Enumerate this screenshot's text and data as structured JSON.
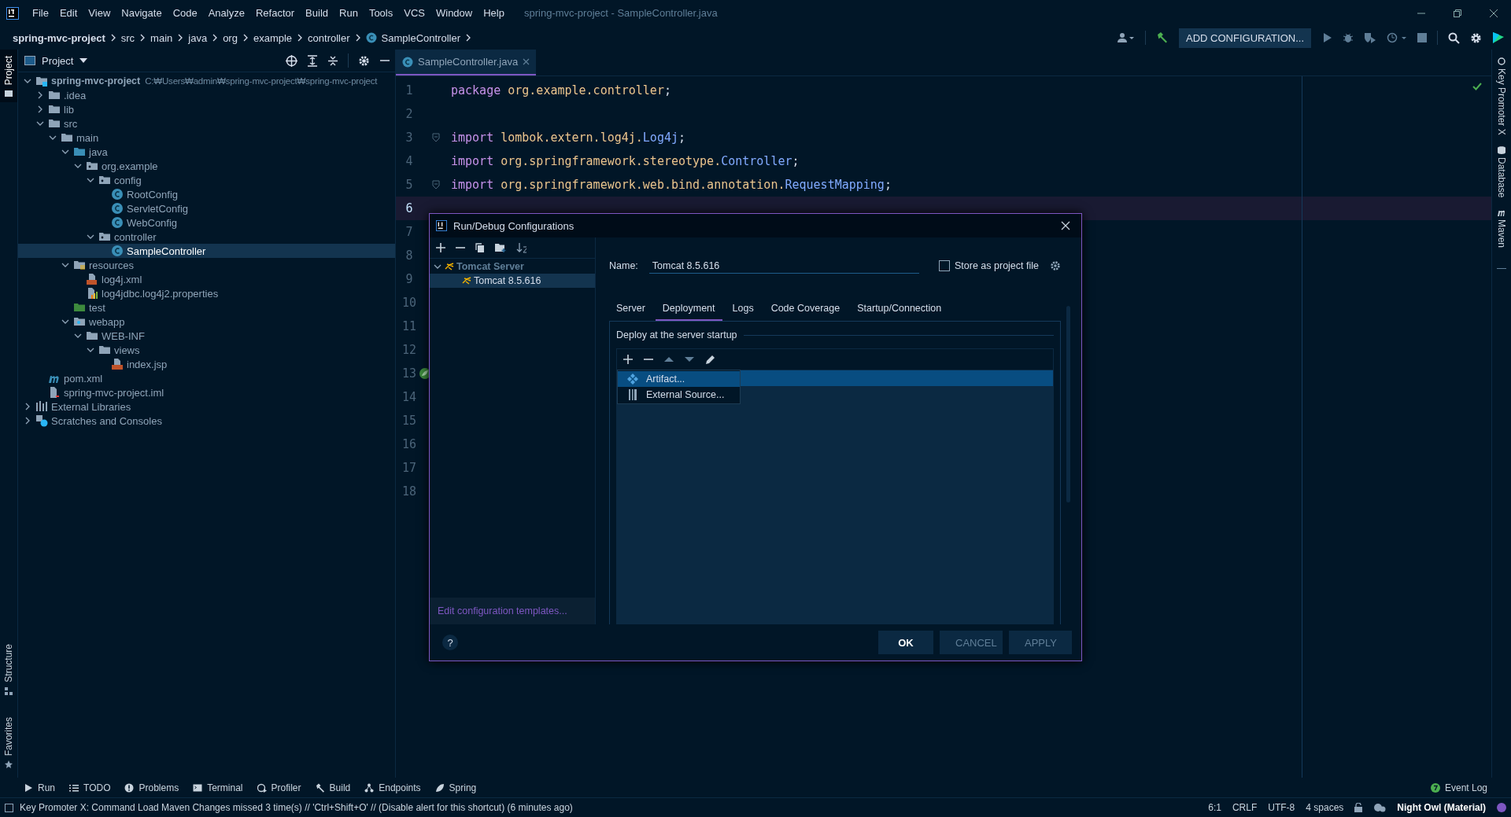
{
  "window": {
    "title": "spring-mvc-project - SampleController.java"
  },
  "menu": [
    "File",
    "Edit",
    "View",
    "Navigate",
    "Code",
    "Analyze",
    "Refactor",
    "Build",
    "Run",
    "Tools",
    "VCS",
    "Window",
    "Help"
  ],
  "breadcrumb": [
    {
      "label": "spring-mvc-project",
      "kind": "project"
    },
    {
      "label": "src",
      "kind": "dir"
    },
    {
      "label": "main",
      "kind": "dir"
    },
    {
      "label": "java",
      "kind": "dir"
    },
    {
      "label": "org",
      "kind": "dir"
    },
    {
      "label": "example",
      "kind": "dir"
    },
    {
      "label": "controller",
      "kind": "dir"
    },
    {
      "label": "SampleController",
      "kind": "class"
    }
  ],
  "toolbar": {
    "config_button": "ADD CONFIGURATION..."
  },
  "left_strip_top": [
    {
      "label": "Project",
      "selected": true,
      "kind": "project"
    }
  ],
  "left_strip_bottom": [
    {
      "label": "Structure",
      "selected": false,
      "kind": "structure"
    },
    {
      "label": "Favorites",
      "selected": false,
      "kind": "favorites"
    }
  ],
  "right_strip": [
    {
      "label": "Key Promoter X",
      "kind": "promoter"
    },
    {
      "label": "Database",
      "kind": "database"
    },
    {
      "label": "Maven",
      "kind": "maven"
    }
  ],
  "project_panel": {
    "title": "Project",
    "tree": [
      {
        "label": "spring-mvc-project",
        "detail": "C:₩Users₩admin₩spring-mvc-project₩spring-mvc-project",
        "kind": "module",
        "expanded": true,
        "selected": false,
        "children": [
          {
            "label": ".idea",
            "kind": "folder",
            "expanded": false,
            "selected": false
          },
          {
            "label": "lib",
            "kind": "folder",
            "expanded": false,
            "selected": false
          },
          {
            "label": "src",
            "kind": "folder",
            "expanded": true,
            "selected": false,
            "children": [
              {
                "label": "main",
                "kind": "folder",
                "expanded": true,
                "selected": false,
                "children": [
                  {
                    "label": "java",
                    "kind": "source",
                    "expanded": true,
                    "selected": false,
                    "children": [
                      {
                        "label": "org.example",
                        "kind": "package",
                        "expanded": true,
                        "selected": false,
                        "children": [
                          {
                            "label": "config",
                            "kind": "package",
                            "expanded": true,
                            "selected": false,
                            "children": [
                              {
                                "label": "RootConfig",
                                "kind": "class",
                                "selected": false
                              },
                              {
                                "label": "ServletConfig",
                                "kind": "class",
                                "selected": false
                              },
                              {
                                "label": "WebConfig",
                                "kind": "class",
                                "selected": false
                              }
                            ]
                          },
                          {
                            "label": "controller",
                            "kind": "package",
                            "expanded": true,
                            "selected": false,
                            "children": [
                              {
                                "label": "SampleController",
                                "kind": "class",
                                "selected": true
                              }
                            ]
                          }
                        ]
                      }
                    ]
                  },
                  {
                    "label": "resources",
                    "kind": "resources",
                    "expanded": true,
                    "selected": false,
                    "children": [
                      {
                        "label": "log4j.xml",
                        "kind": "xml",
                        "selected": false
                      },
                      {
                        "label": "log4jdbc.log4j2.properties",
                        "kind": "properties",
                        "selected": false
                      }
                    ]
                  },
                  {
                    "label": "test",
                    "kind": "test",
                    "selected": false
                  },
                  {
                    "label": "webapp",
                    "kind": "web",
                    "expanded": true,
                    "selected": false,
                    "children": [
                      {
                        "label": "WEB-INF",
                        "kind": "folder",
                        "expanded": true,
                        "selected": false,
                        "children": [
                          {
                            "label": "views",
                            "kind": "folder",
                            "expanded": true,
                            "selected": false,
                            "children": [
                              {
                                "label": "index.jsp",
                                "kind": "jsp",
                                "selected": false
                              }
                            ]
                          }
                        ]
                      }
                    ]
                  }
                ]
              }
            ]
          },
          {
            "label": "pom.xml",
            "kind": "maven",
            "selected": false
          },
          {
            "label": "spring-mvc-project.iml",
            "kind": "iml",
            "selected": false
          }
        ]
      },
      {
        "label": "External Libraries",
        "kind": "libraries",
        "expanded": false,
        "selected": false
      },
      {
        "label": "Scratches and Consoles",
        "kind": "scratches",
        "expanded": false,
        "selected": false
      }
    ]
  },
  "editor": {
    "tabs": [
      {
        "label": "SampleController.java",
        "selected": true
      }
    ],
    "lines": [
      {
        "number": "1",
        "current": false,
        "kind": "plain",
        "tokens": [
          {
            "text": "package ",
            "kind": "keyword"
          },
          {
            "text": "org.example.controller",
            "kind": "package"
          },
          {
            "text": ";",
            "kind": "plain"
          }
        ]
      },
      {
        "number": "2",
        "current": false,
        "kind": "plain"
      },
      {
        "number": "3",
        "current": false,
        "kind": "fold",
        "tokens": [
          {
            "text": "import ",
            "kind": "keyword"
          },
          {
            "text": "lombok.extern.log4j.",
            "kind": "package"
          },
          {
            "text": "Log4j",
            "kind": "class"
          },
          {
            "text": ";",
            "kind": "plain"
          }
        ]
      },
      {
        "number": "4",
        "current": false,
        "kind": "plain",
        "tokens": [
          {
            "text": "import ",
            "kind": "keyword"
          },
          {
            "text": "org.springframework.stereotype.",
            "kind": "package"
          },
          {
            "text": "Controller",
            "kind": "class"
          },
          {
            "text": ";",
            "kind": "plain"
          }
        ]
      },
      {
        "number": "5",
        "current": false,
        "kind": "fold",
        "tokens": [
          {
            "text": "import ",
            "kind": "keyword"
          },
          {
            "text": "org.springframework.web.bind.annotation.",
            "kind": "package"
          },
          {
            "text": "RequestMapping",
            "kind": "class"
          },
          {
            "text": ";",
            "kind": "plain"
          }
        ]
      },
      {
        "number": "6",
        "current": true,
        "kind": "plain"
      },
      {
        "number": "7",
        "current": false,
        "kind": "plain"
      },
      {
        "number": "8",
        "current": false,
        "kind": "plain"
      },
      {
        "number": "9",
        "current": false,
        "kind": "plain"
      },
      {
        "number": "10",
        "current": false,
        "kind": "plain"
      },
      {
        "number": "11",
        "current": false,
        "kind": "plain"
      },
      {
        "number": "12",
        "current": false,
        "kind": "plain"
      },
      {
        "number": "13",
        "current": false,
        "kind": "bean"
      },
      {
        "number": "14",
        "current": false,
        "kind": "plain"
      },
      {
        "number": "15",
        "current": false,
        "kind": "plain"
      },
      {
        "number": "16",
        "current": false,
        "kind": "plain"
      },
      {
        "number": "17",
        "current": false,
        "kind": "plain"
      },
      {
        "number": "18",
        "current": false,
        "kind": "plain"
      }
    ]
  },
  "dialog": {
    "title": "Run/Debug Configurations",
    "tree": [
      {
        "label": "Tomcat Server",
        "expanded": true,
        "selected": false,
        "children": [
          {
            "label": "Tomcat 8.5.616",
            "selected": true
          }
        ]
      }
    ],
    "templates_link": "Edit configuration templates...",
    "name_label": "Name:",
    "name_value": "Tomcat 8.5.616",
    "store_option": {
      "label": "Store as project file",
      "checked": false
    },
    "tabs": [
      {
        "label": "Server",
        "selected": false
      },
      {
        "label": "Deployment",
        "selected": true
      },
      {
        "label": "Logs",
        "selected": false
      },
      {
        "label": "Code Coverage",
        "selected": false
      },
      {
        "label": "Startup/Connection",
        "selected": false
      }
    ],
    "section_title": "Deploy at the server startup",
    "add_menu": [
      {
        "label": "Artifact...",
        "kind": "artifact",
        "selected": true
      },
      {
        "label": "External Source...",
        "kind": "external",
        "selected": false
      }
    ],
    "help": "?",
    "buttons": [
      {
        "label": "OK",
        "kind": "primary"
      },
      {
        "label": "CANCEL",
        "kind": "normal"
      },
      {
        "label": "APPLY",
        "kind": "normal"
      }
    ]
  },
  "tool_windows": [
    {
      "label": "Run",
      "kind": "run"
    },
    {
      "label": "TODO",
      "kind": "todo"
    },
    {
      "label": "Problems",
      "kind": "problems"
    },
    {
      "label": "Terminal",
      "kind": "terminal"
    },
    {
      "label": "Profiler",
      "kind": "profiler"
    },
    {
      "label": "Build",
      "kind": "build"
    },
    {
      "label": "Endpoints",
      "kind": "endpoints"
    },
    {
      "label": "Spring",
      "kind": "spring"
    }
  ],
  "event_log": "Event Log",
  "status_bar": {
    "message": "Key Promoter X: Command Load Maven Changes missed 3 time(s) // 'Ctrl+Shift+O' // (Disable alert for this shortcut) (6 minutes ago)",
    "position": "6:1",
    "line_separator": "CRLF",
    "encoding": "UTF-8",
    "indent": "4 spaces",
    "theme": "Night Owl (Material)"
  }
}
